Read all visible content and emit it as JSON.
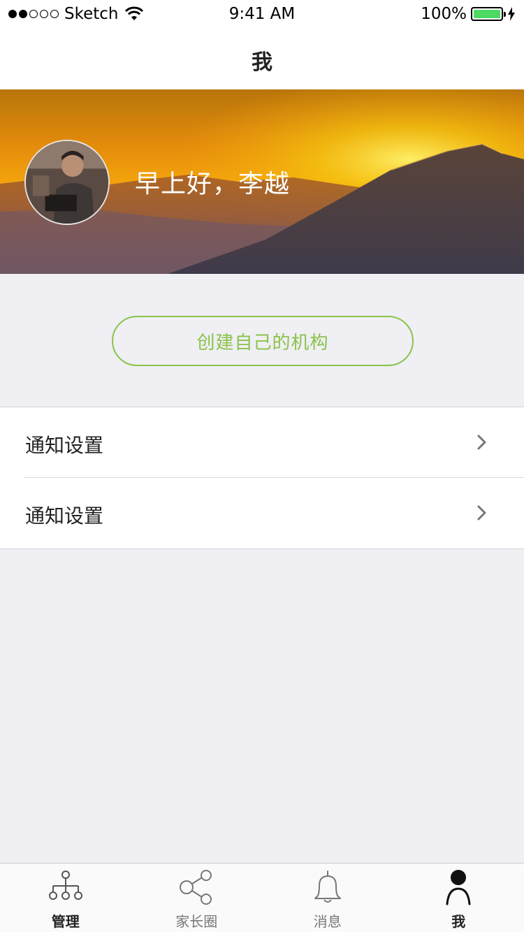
{
  "status_bar": {
    "carrier": "Sketch",
    "time": "9:41 AM",
    "battery": "100%",
    "signal_strength": 2,
    "signal_total": 5,
    "battery_color": "#4cd964"
  },
  "nav": {
    "title": "我"
  },
  "banner": {
    "greeting": "早上好，李越"
  },
  "create_button": {
    "label": "创建自己的机构",
    "color": "#8bc34a"
  },
  "settings": {
    "items": [
      {
        "label": "通知设置",
        "icon": "chevron-right-icon"
      },
      {
        "label": "通知设置",
        "icon": "chevron-right-icon"
      }
    ]
  },
  "tab_bar": {
    "tabs": [
      {
        "label": "管理",
        "icon": "org-chart-icon",
        "active": false
      },
      {
        "label": "家长圈",
        "icon": "share-icon",
        "active": false
      },
      {
        "label": "消息",
        "icon": "bell-icon",
        "active": false
      },
      {
        "label": "我",
        "icon": "person-icon",
        "active": true
      }
    ]
  }
}
